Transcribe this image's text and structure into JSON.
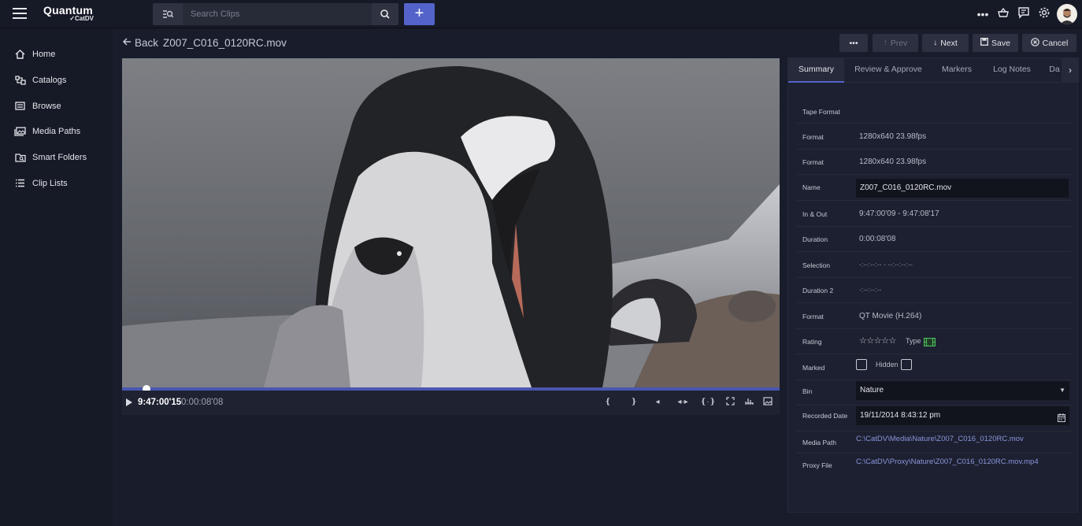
{
  "brand": {
    "name": "Quantum",
    "sub": "CatDV"
  },
  "search": {
    "placeholder": "Search Clips"
  },
  "sidebar": {
    "items": [
      {
        "label": "Home",
        "icon": "home-icon"
      },
      {
        "label": "Catalogs",
        "icon": "catalogs-icon"
      },
      {
        "label": "Browse",
        "icon": "browse-icon"
      },
      {
        "label": "Media Paths",
        "icon": "media-paths-icon"
      },
      {
        "label": "Smart Folders",
        "icon": "smart-folders-icon"
      },
      {
        "label": "Clip Lists",
        "icon": "clip-lists-icon"
      }
    ]
  },
  "header": {
    "back_label": "Back",
    "clip_name": "Z007_C016_0120RC.mov"
  },
  "actions": {
    "more": "•••",
    "prev": "Prev",
    "next": "Next",
    "save": "Save",
    "cancel": "Cancel"
  },
  "player": {
    "current_time": "9:47:00'15",
    "duration": "0:00:08'08",
    "playhead_fraction": 0.04
  },
  "tabs": [
    "Summary",
    "Review & Approve",
    "Markers",
    "Log Notes",
    "Da"
  ],
  "summary": {
    "tape_format_label": "Tape Format",
    "format1_label": "Format",
    "format1_value": "1280x640 23.98fps",
    "format2_label": "Format",
    "format2_value": "1280x640 23.98fps",
    "name_label": "Name",
    "name_value": "Z007_C016_0120RC.mov",
    "inout_label": "In & Out",
    "inout_value": "9:47:00'09 - 9:47:08'17",
    "duration_label": "Duration",
    "duration_value": "0:00:08'08",
    "selection_label": "Selection",
    "selection_value": "-:--:--:-- - --:--:--:--",
    "duration2_label": "Duration 2",
    "duration2_value": "-:--:--:--",
    "format3_label": "Format",
    "format3_value": "QT Movie (H.264)",
    "rating_label": "Rating",
    "rating_stars": "☆☆☆☆☆",
    "type_label": "Type",
    "marked_label": "Marked",
    "hidden_label": "Hidden",
    "bin_label": "Bin",
    "bin_value": "Nature",
    "recorded_label": "Recorded Date",
    "recorded_value": "19/11/2014 8:43:12 pm",
    "media_path_label": "Media Path",
    "media_path_value": "C:\\CatDV\\Media\\Nature\\Z007_C016_0120RC.mov",
    "proxy_label": "Proxy File",
    "proxy_value": "C:\\CatDV\\Proxy\\Nature\\Z007_C016_0120RC.mov.mp4"
  },
  "colors": {
    "accent": "#5363c9",
    "background": "#161926",
    "panel": "#1d2030",
    "link": "#8996dd"
  }
}
